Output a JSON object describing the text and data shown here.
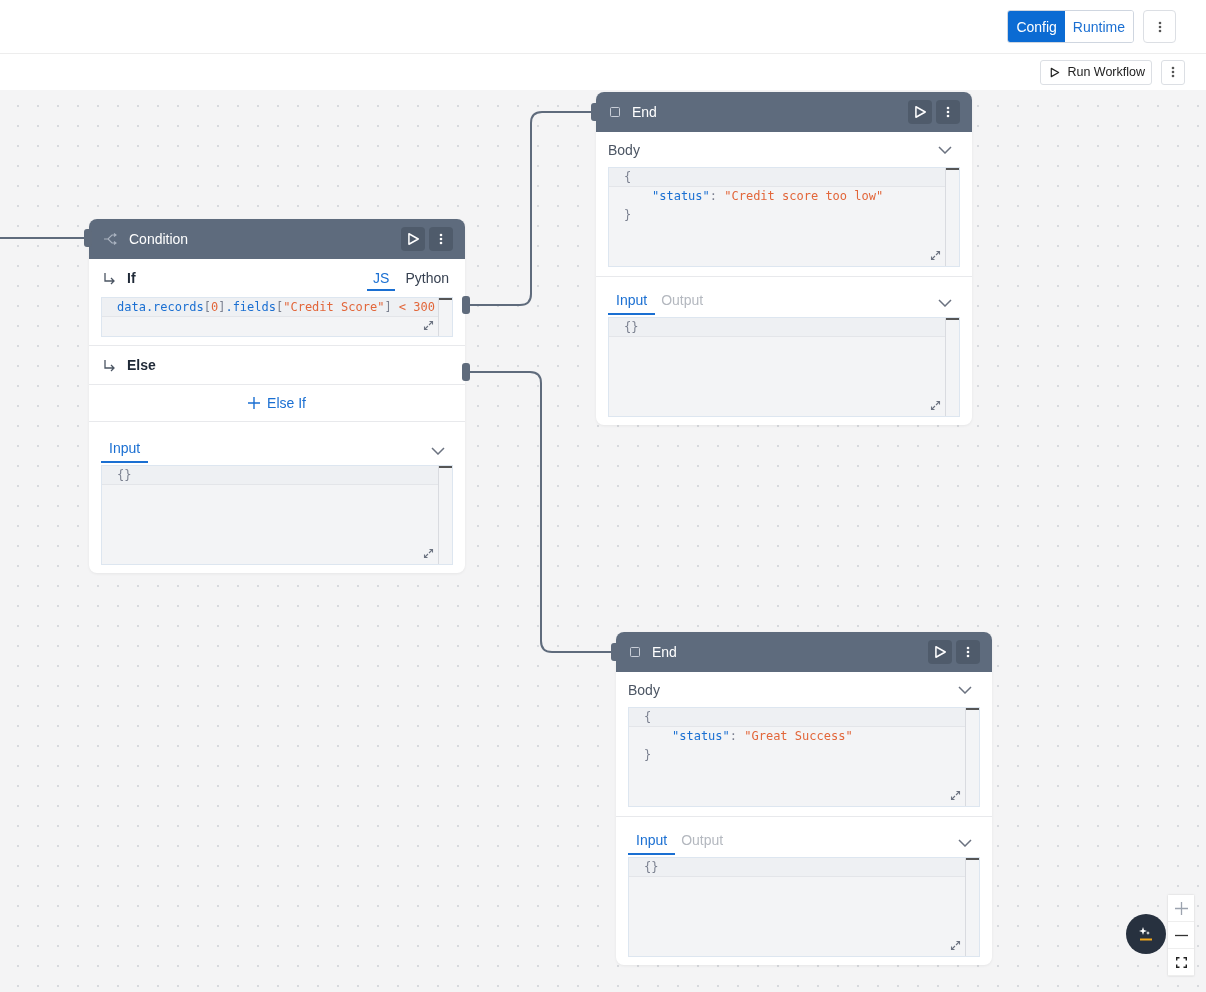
{
  "header": {
    "view_tabs": [
      {
        "label": "Config",
        "selected": true
      },
      {
        "label": "Runtime",
        "selected": false
      }
    ]
  },
  "toolbar": {
    "run_button": "Run Workflow"
  },
  "nodes": [
    {
      "kind": "condition",
      "title": "Condition",
      "branches": [
        {
          "kind": "if",
          "label": "If",
          "languages": [
            {
              "label": "JS",
              "selected": true
            },
            {
              "label": "Python",
              "selected": false
            }
          ],
          "code": [
            {
              "tokens": [
                {
                  "kind": "ident",
                  "text": "data.records"
                },
                {
                  "kind": "punct",
                  "text": "["
                },
                {
                  "kind": "number",
                  "text": "0"
                },
                {
                  "kind": "punct",
                  "text": "]"
                },
                {
                  "kind": "ident",
                  "text": ".fields"
                },
                {
                  "kind": "punct",
                  "text": "["
                },
                {
                  "kind": "string",
                  "text": "\"Credit Score\""
                },
                {
                  "kind": "punct",
                  "text": "] "
                },
                {
                  "kind": "number",
                  "text": "< 300"
                }
              ]
            }
          ]
        },
        {
          "kind": "else",
          "label": "Else"
        }
      ],
      "add_branch": "Else If",
      "panel": {
        "tabs": [
          {
            "label": "Input",
            "selected": true
          }
        ],
        "code": [
          {
            "tokens": [
              {
                "kind": "punct",
                "text": "{}"
              }
            ]
          }
        ]
      }
    },
    {
      "kind": "end",
      "title": "End",
      "body": {
        "label": "Body",
        "code": [
          {
            "kind": "brace",
            "tokens": [
              {
                "kind": "punct",
                "text": "{"
              }
            ]
          },
          {
            "kind": "member",
            "tokens": [
              {
                "kind": "ident",
                "text": "\"status\""
              },
              {
                "kind": "punct",
                "text": ": "
              },
              {
                "kind": "string",
                "text": "\"Credit score too low\""
              }
            ]
          },
          {
            "kind": "brace",
            "tokens": [
              {
                "kind": "punct",
                "text": "}"
              }
            ]
          }
        ]
      },
      "panel": {
        "tabs": [
          {
            "label": "Input",
            "selected": true
          },
          {
            "label": "Output",
            "selected": false
          }
        ],
        "code": [
          {
            "tokens": [
              {
                "kind": "punct",
                "text": "{}"
              }
            ]
          }
        ]
      }
    },
    {
      "kind": "end",
      "title": "End",
      "body": {
        "label": "Body",
        "code": [
          {
            "kind": "brace",
            "tokens": [
              {
                "kind": "punct",
                "text": "{"
              }
            ]
          },
          {
            "kind": "member",
            "tokens": [
              {
                "kind": "ident",
                "text": "\"status\""
              },
              {
                "kind": "punct",
                "text": ": "
              },
              {
                "kind": "string",
                "text": "\"Great Success\""
              }
            ]
          },
          {
            "kind": "brace",
            "tokens": [
              {
                "kind": "punct",
                "text": "}"
              }
            ]
          }
        ]
      },
      "panel": {
        "tabs": [
          {
            "label": "Input",
            "selected": true
          },
          {
            "label": "Output",
            "selected": false
          }
        ],
        "code": [
          {
            "tokens": [
              {
                "kind": "punct",
                "text": "{}"
              }
            ]
          }
        ]
      }
    }
  ]
}
